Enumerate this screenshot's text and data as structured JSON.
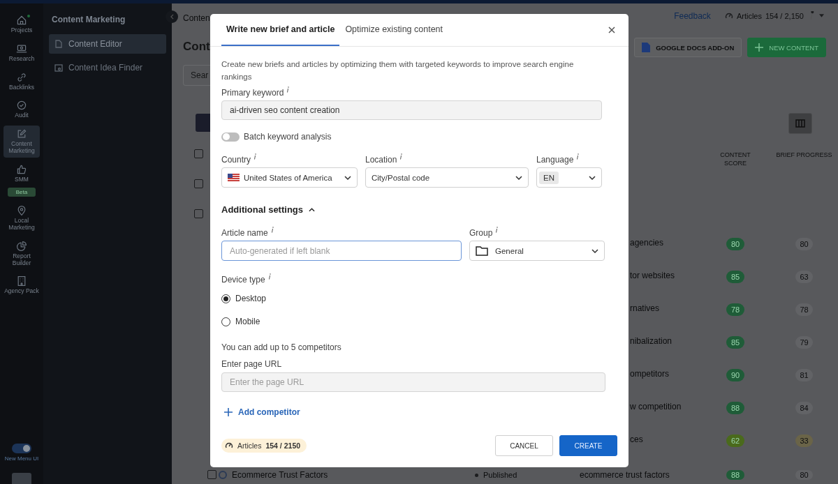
{
  "rail": {
    "items": [
      {
        "label": "Projects",
        "selected": false,
        "notification": true
      },
      {
        "label": "Research",
        "selected": false,
        "notification": false
      },
      {
        "label": "Backlinks",
        "selected": false,
        "notification": false
      },
      {
        "label": "Audit",
        "selected": false,
        "notification": false
      },
      {
        "label": "Content Marketing",
        "selected": true,
        "notification": false
      },
      {
        "label": "SMM",
        "selected": false,
        "notification": false,
        "badge": "Beta"
      },
      {
        "label": "Local Marketing",
        "selected": false,
        "notification": false
      },
      {
        "label": "Report Builder",
        "selected": false,
        "notification": false
      },
      {
        "label": "Agency Pack",
        "selected": false,
        "notification": false
      }
    ],
    "toggle": {
      "label": "New Menu UI",
      "on": true
    }
  },
  "subnav": {
    "title": "Content Marketing",
    "items": [
      {
        "label": "Content Editor",
        "selected": true
      },
      {
        "label": "Content Idea Finder",
        "selected": false
      }
    ]
  },
  "main": {
    "breadcrumb": "Conten",
    "title": "Cont",
    "search_placeholder": "Sear",
    "feedback": "Feedback",
    "quota": {
      "label": "Articles",
      "value": "154 / 2,150"
    },
    "buttons": [
      {
        "label": "GOOGLE DOCS ADD-ON",
        "kind": "outline"
      },
      {
        "label": "NEW CONTENT",
        "kind": "primary"
      }
    ],
    "columns": [
      "CONTENT SCORE",
      "BRIEF PROGRESS"
    ],
    "header_checkboxes": [
      {
        "checked": false
      },
      {
        "checked": false
      },
      {
        "checked": false
      }
    ],
    "rows": [
      {
        "title": "agencies",
        "score": "80",
        "progress": "80",
        "color": "#1f5c38"
      },
      {
        "title": "tor websites",
        "score": "85",
        "progress": "63",
        "color": "#1f5c38"
      },
      {
        "title": "rnatives",
        "score": "78",
        "progress": "78",
        "color": "#1f5c38"
      },
      {
        "title": "nibalization",
        "score": "85",
        "progress": "79",
        "color": "#1f5c38"
      },
      {
        "title": "ompetitors",
        "score": "90",
        "progress": "81",
        "color": "#1f5c38"
      },
      {
        "title": "w competition",
        "score": "88",
        "progress": "84",
        "color": "#1f5c38"
      },
      {
        "title": "ces",
        "score": "62",
        "progress": "33",
        "color": "#4a6a1c"
      }
    ],
    "last_row": {
      "checked": false,
      "title": "Ecommerce Trust Factors",
      "status": "Published",
      "keyword": "ecommerce trust factors",
      "score": "88",
      "progress": "80",
      "color": "#1f5c38"
    }
  },
  "dialog": {
    "tabs": [
      {
        "label": "Write new brief and article",
        "selected": true
      },
      {
        "label": "Optimize existing content",
        "selected": false
      }
    ],
    "description": "Create new briefs and articles by optimizing them with targeted keywords to improve search engine rankings",
    "primary_keyword": {
      "label": "Primary keyword",
      "value": "ai-driven seo content creation"
    },
    "batch": {
      "label": "Batch keyword analysis",
      "on": false
    },
    "selects": [
      {
        "label": "Country",
        "value": "United States of America",
        "kind": "country"
      },
      {
        "label": "Location",
        "value": "City/Postal code",
        "kind": "plain"
      },
      {
        "label": "Language",
        "value": "EN",
        "kind": "chip"
      }
    ],
    "additional": {
      "label": "Additional settings",
      "expanded": true
    },
    "article_name": {
      "label": "Article name",
      "placeholder": "Auto-generated if left blank"
    },
    "group": {
      "label": "Group",
      "value": "General"
    },
    "device": {
      "label": "Device type",
      "options": [
        {
          "label": "Desktop",
          "selected": true
        },
        {
          "label": "Mobile",
          "selected": false
        }
      ]
    },
    "competitors_note": "You can add up to 5 competitors",
    "url": {
      "label": "Enter page URL",
      "placeholder": "Enter the page URL"
    },
    "add_competitor": "Add competitor",
    "quota": {
      "label": "Articles",
      "value": "154 / 2150"
    },
    "buttons": [
      {
        "label": "CANCEL",
        "kind": "secondary"
      },
      {
        "label": "CREATE",
        "kind": "primary"
      }
    ]
  }
}
